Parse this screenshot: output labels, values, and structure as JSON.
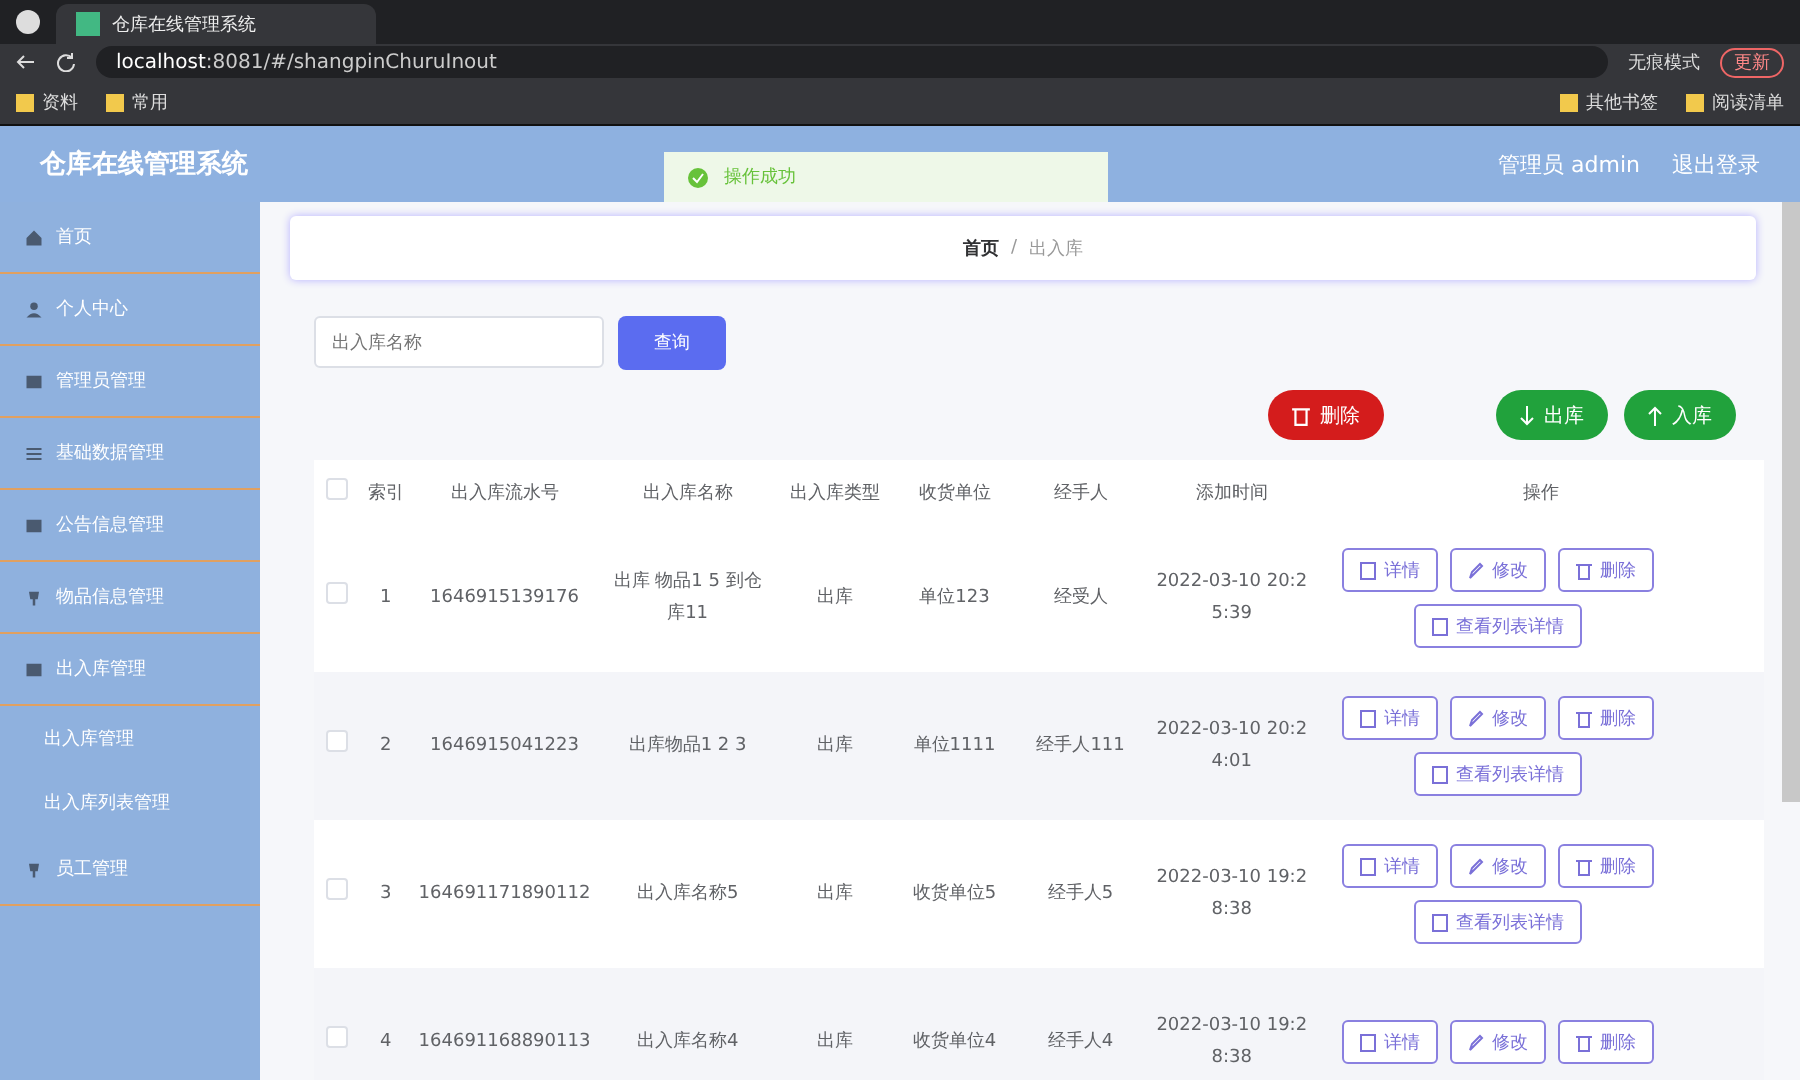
{
  "browser": {
    "tab_title": "仓库在线管理系统",
    "url_host": "localhost",
    "url_rest": ":8081/#/shangpinChuruInout",
    "mode_label": "无痕模式",
    "update_button": "更新",
    "bookmarks": [
      "资料",
      "常用"
    ],
    "bookmarks_right": [
      "其他书签",
      "阅读清单"
    ]
  },
  "header": {
    "title": "仓库在线管理系统",
    "user": "管理员 admin",
    "logout": "退出登录"
  },
  "toast": {
    "text": "操作成功"
  },
  "sidebar": {
    "items": [
      {
        "label": "首页",
        "kind": "home"
      },
      {
        "label": "个人中心",
        "kind": "person"
      },
      {
        "label": "管理员管理",
        "kind": "card"
      },
      {
        "label": "基础数据管理",
        "kind": "list"
      },
      {
        "label": "公告信息管理",
        "kind": "card"
      },
      {
        "label": "物品信息管理",
        "kind": "pin"
      },
      {
        "label": "出入库管理",
        "kind": "card",
        "children": [
          {
            "label": "出入库管理"
          },
          {
            "label": "出入库列表管理"
          }
        ]
      },
      {
        "label": "员工管理",
        "kind": "pin"
      }
    ]
  },
  "breadcrumb": {
    "items": [
      "首页",
      "出入库"
    ],
    "separator": "/"
  },
  "search": {
    "placeholder": "出入库名称",
    "button": "查询"
  },
  "actions": [
    {
      "label": "删除",
      "kind": "danger"
    },
    {
      "label": "出库",
      "kind": "out"
    },
    {
      "label": "入库",
      "kind": "in"
    }
  ],
  "table": {
    "header_checked": false,
    "columns": [
      "索引",
      "出入库流水号",
      "出入库名称",
      "出入库类型",
      "收货单位",
      "经手人",
      "添加时间",
      "操作"
    ],
    "rows": [
      {
        "checked": false,
        "cells": [
          "1",
          "1646915139176",
          "出库 物品1 5 到仓库11",
          "出库",
          "单位123",
          "经受人",
          "2022-03-10 20:25:39"
        ],
        "buttons": [
          "详情",
          "修改",
          "删除",
          "查看列表详情"
        ]
      },
      {
        "checked": false,
        "cells": [
          "2",
          "1646915041223",
          "出库物品1 2 3",
          "出库",
          "单位1111",
          "经手人111",
          "2022-03-10 20:24:01"
        ],
        "buttons": [
          "详情",
          "修改",
          "删除",
          "查看列表详情"
        ]
      },
      {
        "checked": false,
        "cells": [
          "3",
          "164691171890112",
          "出入库名称5",
          "出库",
          "收货单位5",
          "经手人5",
          "2022-03-10 19:28:38"
        ],
        "buttons": [
          "详情",
          "修改",
          "删除",
          "查看列表详情"
        ]
      },
      {
        "checked": false,
        "cells": [
          "4",
          "164691168890113",
          "出入库名称4",
          "出库",
          "收货单位4",
          "经手人4",
          "2022-03-10 19:28:38"
        ],
        "buttons": [
          "详情",
          "修改",
          "删除"
        ]
      }
    ]
  }
}
